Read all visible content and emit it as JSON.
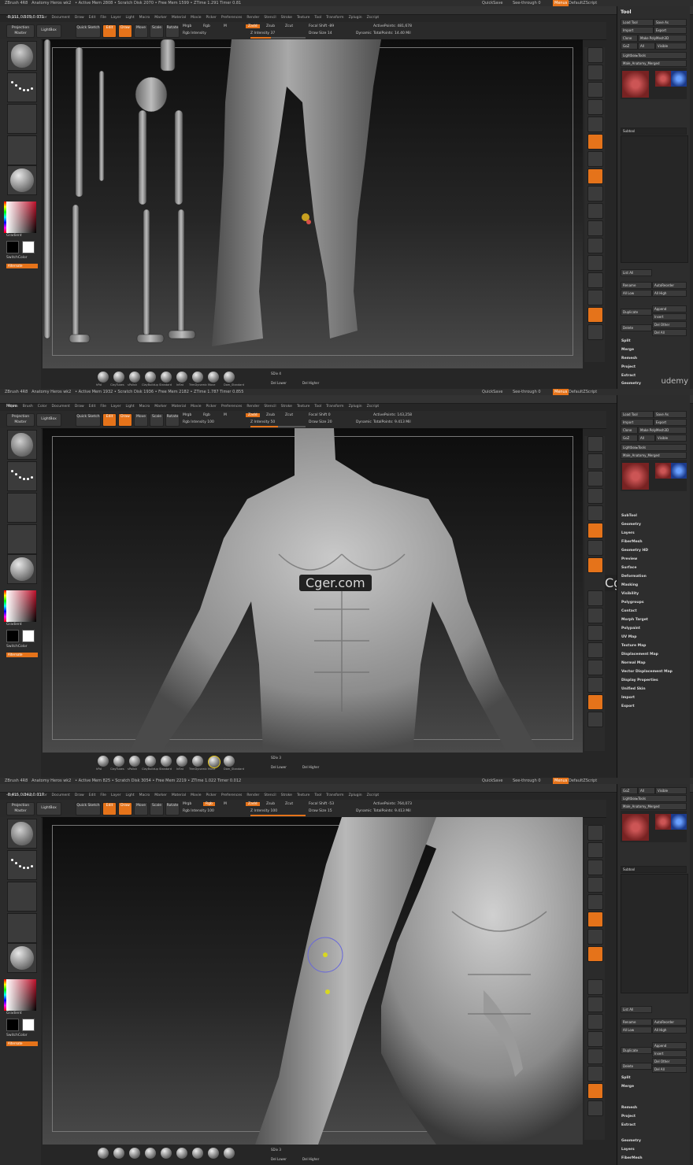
{
  "app": {
    "name": "ZBrush 4R8",
    "document": "Anatomy Heros wk2",
    "quicksave": "QuickSave",
    "seethrough": "See-through 0",
    "menus_label": "Menus",
    "script": "DefaultZScript"
  },
  "menus": [
    "Alpha",
    "Brush",
    "Color",
    "Document",
    "Draw",
    "Edit",
    "File",
    "Layer",
    "Light",
    "Macro",
    "Marker",
    "Material",
    "Movie",
    "Picker",
    "Preferences",
    "Render",
    "Stencil",
    "Stroke",
    "Texture",
    "Tool",
    "Transform",
    "Zplugin",
    "Zscript"
  ],
  "frames": [
    {
      "title_stats": "• Active Mem 2808 • Scratch Disk 2070 • Free Mem 1599 • ZTime 1.291 Timer 0.81",
      "coords": "-0.111,0.575,0.071",
      "focal_shift": "Focal Shift -89",
      "draw_size": "Draw Size 14",
      "active_points": "ActivePoints: 481,678",
      "total_points": "TotalPoints: 14.40 Mil",
      "intensity": "Z Intensity 37",
      "rgb_intensity": "Rgb Intensity",
      "sdiv": "SDiv 4",
      "del_lower": "Del Lower",
      "del_higher": "Del Higher",
      "watermark": "",
      "udemy": "udemy"
    },
    {
      "title_stats": "• Active Mem 1932 • Scratch Disk 1936 • Free Mem 2182 • ZTime 1.787 Timer 0.855",
      "coords": "",
      "focal_shift": "Focal Shift 0",
      "draw_size": "Draw Size 20",
      "active_points": "ActivePoints: 143,258",
      "total_points": "TotalPoints: 9.413 Mil",
      "intensity": "Z Intensity 50",
      "rgb_intensity": "Rgb Intensity 100",
      "sdiv": "SDiv 3",
      "del_lower": "Del Lower",
      "del_higher": "Del Higher",
      "watermark": "Cger.com",
      "udemy": ""
    },
    {
      "title_stats": "• Active Mem 825 • Scratch Disk 3054 • Free Mem 2219 • ZTime 1.022 Timer 0.012",
      "coords": "-0.415,0.342,0.017",
      "focal_shift": "Focal Shift -53",
      "draw_size": "Draw Size 15",
      "active_points": "ActivePoints: 764,073",
      "total_points": "TotalPoints: 9.413 Mil",
      "intensity": "Z Intensity 100",
      "rgb_intensity": "Rgb Intensity 100",
      "sdiv": "SDiv 3",
      "del_lower": "Del Lower",
      "del_higher": "Del Higher",
      "watermark": "",
      "udemy": ""
    }
  ],
  "toolbar": {
    "projection_master": "Projection Master",
    "lightbox": "LightBox",
    "quick_sketch": "Quick Sketch",
    "edit": "Edit",
    "draw": "Draw",
    "move": "Move",
    "scale": "Scale",
    "rotate": "Rotate",
    "mrgb": "Mrgb",
    "rgb": "Rgb",
    "m": "M",
    "zadd": "Zadd",
    "zsub": "Zsub",
    "zcut": "Zcut",
    "dynamic": "Dynamic"
  },
  "left_shelf": {
    "gradient": "Gradient",
    "switch_color": "SwitchColor",
    "alternate": "Alternate"
  },
  "brushes": [
    "hPol",
    "ClayTubes",
    "sPolish",
    "ClayBuildup",
    "Standard",
    "Inflat",
    "TrimDynamic",
    "Move",
    "Dam_Standard"
  ],
  "tool_panel": {
    "title": "Tool",
    "load_tool": "Load Tool",
    "save_as": "Save As",
    "import": "Import",
    "export": "Export",
    "clone": "Clone",
    "make_polymesh": "Make PolyMesh3D",
    "goz": "GoZ",
    "all": "All",
    "visible": "Visible",
    "lightbox_tools": "Lightbox▸Tools",
    "current_tool": "Male_Anatomy_Merged",
    "subtool": "Subtool",
    "list_all": "List All",
    "rename": "Rename",
    "autoreorder": "AutoReorder",
    "all_low": "All Low",
    "all_high": "All High",
    "duplicate": "Duplicate",
    "append": "Append",
    "insert": "Insert",
    "delete": "Delete",
    "del_other": "Del Other",
    "del_all": "Del All",
    "split": "Split",
    "merge": "Merge",
    "remesh": "Remesh",
    "project": "Project",
    "extract": "Extract",
    "geometry": "Geometry",
    "sections": [
      "SubTool",
      "Geometry",
      "Layers",
      "FiberMesh",
      "Geometry HD",
      "Preview",
      "Surface",
      "Deformation",
      "Masking",
      "Visibility",
      "Polygroups",
      "Contact",
      "Morph Target",
      "Polypaint",
      "UV Map",
      "Texture Map",
      "Displacement Map",
      "Normal Map",
      "Vector Displacement Map",
      "Display Properties",
      "Unified Skin",
      "Import",
      "Export"
    ]
  },
  "colors": {
    "accent": "#e5731a",
    "panel": "#2d2d2d",
    "viewport_top": "#0d0d0d",
    "viewport_bottom": "#4a4a4a"
  }
}
